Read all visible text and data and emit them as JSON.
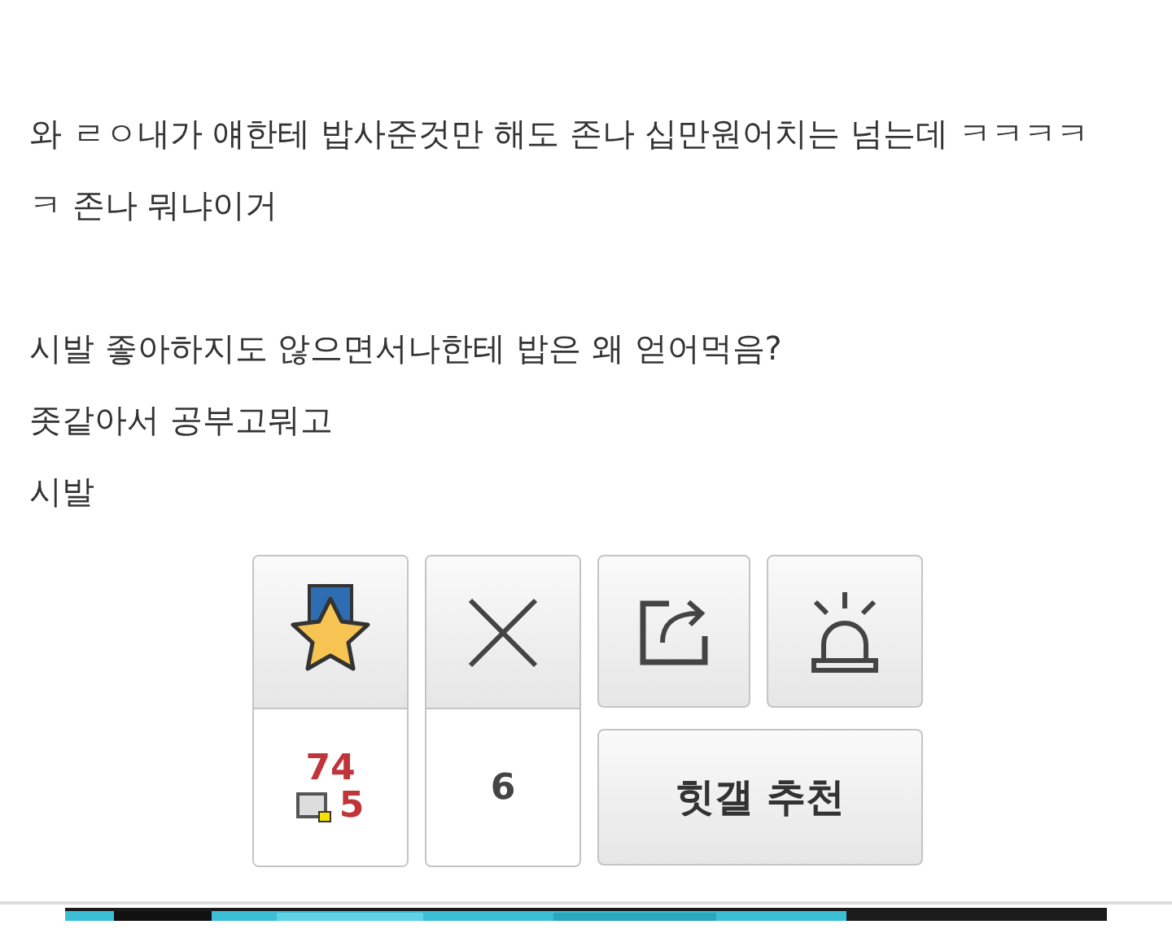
{
  "post_body": [
    {
      "lines": [
        "와 ㄹㅇ내가 얘한테 밥사준것만 해도 존나 십만원어치는 넘는데 ㅋㅋㅋㅋㅋ 존나 뭐냐이거"
      ]
    },
    {
      "lines": [
        "시발 좋아하지도 않으면서나한테 밥은 왜 얻어먹음?",
        "좃같아서 공부고뭐고",
        "시발"
      ]
    }
  ],
  "recommend": {
    "count": "74",
    "fixed_count": "5"
  },
  "dislike": {
    "count": "6"
  },
  "hit_button": {
    "label": "힛갤 추천"
  }
}
